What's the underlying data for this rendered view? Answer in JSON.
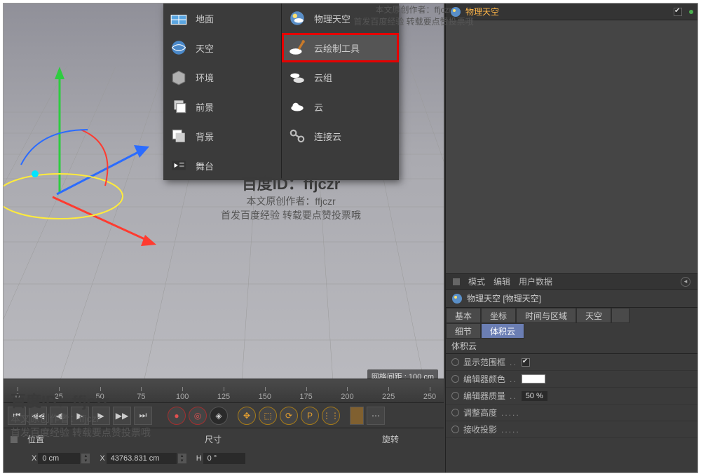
{
  "viewport": {
    "grid_label": "网格间距 : 100 cm"
  },
  "menu": {
    "left": [
      {
        "label": "地面",
        "icon": "floor"
      },
      {
        "label": "天空",
        "icon": "sky"
      },
      {
        "label": "环境",
        "icon": "env"
      },
      {
        "label": "前景",
        "icon": "fore"
      },
      {
        "label": "背景",
        "icon": "back"
      },
      {
        "label": "舞台",
        "icon": "stage"
      }
    ],
    "right": [
      {
        "label": "物理天空",
        "icon": "psky"
      },
      {
        "label": "云绘制工具",
        "icon": "cloudtool",
        "hl": true
      },
      {
        "label": "云组",
        "icon": "cloudgrp"
      },
      {
        "label": "云",
        "icon": "cloud"
      },
      {
        "label": "连接云",
        "icon": "link"
      }
    ]
  },
  "side": {
    "title": "物理天空",
    "attr_menu": [
      "模式",
      "编辑",
      "用户数据"
    ],
    "obj_label": "物理天空 [物理天空]",
    "tabs_row1": [
      "基本",
      "坐标",
      "时间与区域",
      "天空"
    ],
    "tabs_row2": [
      "细节",
      "体积云"
    ],
    "active_tab": "体积云",
    "section": "体积云",
    "props": [
      {
        "name": "显示范围框",
        "type": "check",
        "value": true
      },
      {
        "name": "编辑器颜色",
        "type": "color",
        "value": "#ffffff"
      },
      {
        "name": "编辑器质量",
        "type": "num",
        "value": "50 %"
      },
      {
        "name": "调整高度",
        "type": "toggle"
      },
      {
        "name": "接收投影",
        "type": "toggle"
      }
    ]
  },
  "timeline": {
    "marks": [
      0,
      25,
      50,
      75,
      100,
      125,
      150,
      175,
      200,
      225,
      250
    ]
  },
  "coord": {
    "headers": [
      "位置",
      "尺寸",
      "旋转"
    ],
    "row": {
      "pos": "0 cm",
      "size": "43763.831 cm",
      "rot_label": "H",
      "rot": "0 °",
      "axis": "X",
      "size_axis": "X"
    }
  },
  "watermark": {
    "id_label": "百度ID：",
    "id_value": "ffjczr",
    "line1": "本文原创作者：ffjczr",
    "line2": "首发百度经验 转载要点赞投票哦"
  }
}
